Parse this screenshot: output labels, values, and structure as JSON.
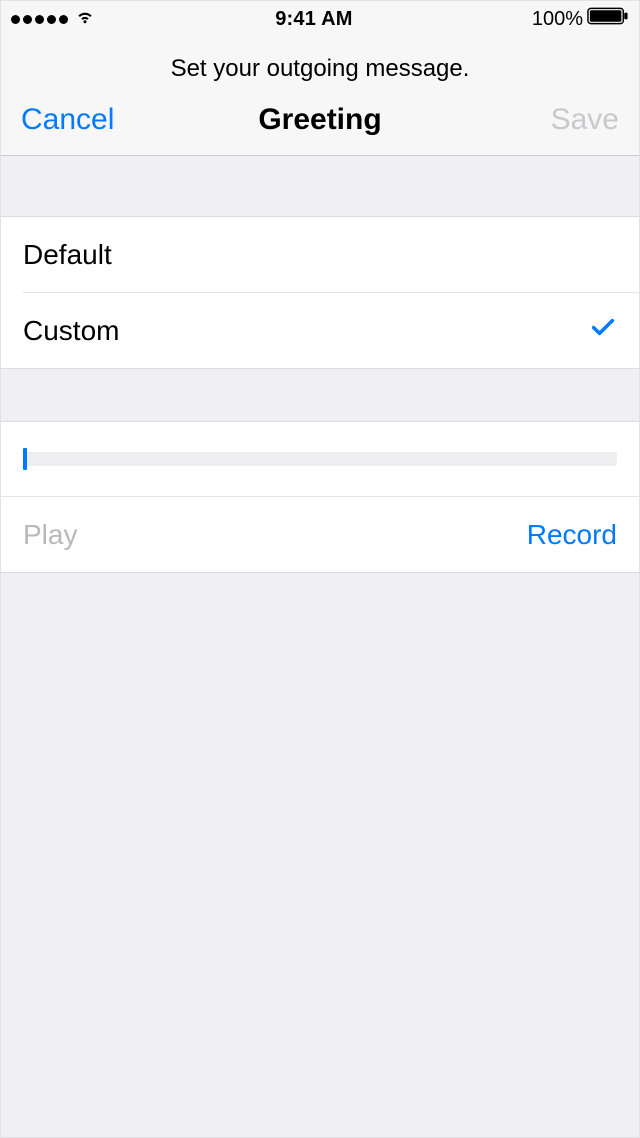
{
  "status_bar": {
    "time": "9:41 AM",
    "battery_percent": "100%"
  },
  "header": {
    "subtitle": "Set your outgoing message.",
    "cancel_label": "Cancel",
    "title": "Greeting",
    "save_label": "Save"
  },
  "options": {
    "default_label": "Default",
    "custom_label": "Custom",
    "selected": "custom"
  },
  "controls": {
    "play_label": "Play",
    "record_label": "Record"
  },
  "progress": {
    "position_percent": 0
  }
}
